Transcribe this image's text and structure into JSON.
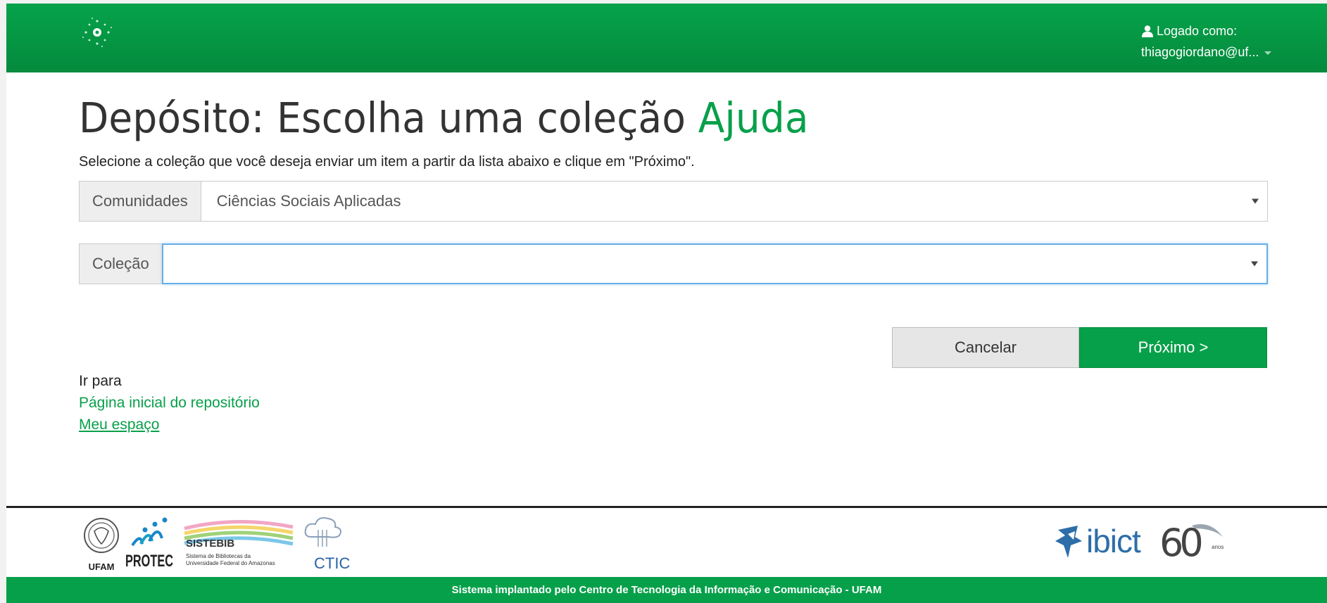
{
  "navbar": {
    "user_label": "Logado como:",
    "user_email": "thiagogiordano@uf..."
  },
  "page": {
    "title": "Depósito: Escolha uma coleção",
    "help_link": "Ajuda",
    "instructions": "Selecione a coleção que você deseja enviar um item a partir da lista abaixo e clique em \"Próximo\"."
  },
  "form": {
    "communities_label": "Comunidades",
    "communities_value": "Ciências Sociais Aplicadas",
    "collection_label": "Coleção",
    "collection_value": ""
  },
  "buttons": {
    "cancel": "Cancelar",
    "next": "Próximo >"
  },
  "goto": {
    "label": "Ir para",
    "home_link": "Página inicial do repositório",
    "my_space_link": "Meu espaço"
  },
  "footer": {
    "partners": {
      "ufam": "UFAM",
      "protec": "PROTEC",
      "sistebib": "SISTEBIB",
      "sistebib_sub1": "Sistema de Bibliotecas da",
      "sistebib_sub2": "Universidade Federal do Amazonas",
      "ctic": "CTIC"
    },
    "ibict": {
      "name": "ibict",
      "number": "60",
      "suffix": "anos"
    },
    "bar_text": "Sistema implantado pelo Centro de Tecnologia da Informação e Comunicação - UFAM"
  },
  "colors": {
    "brand_green": "#07a04a",
    "focus_blue": "#66afe9"
  }
}
